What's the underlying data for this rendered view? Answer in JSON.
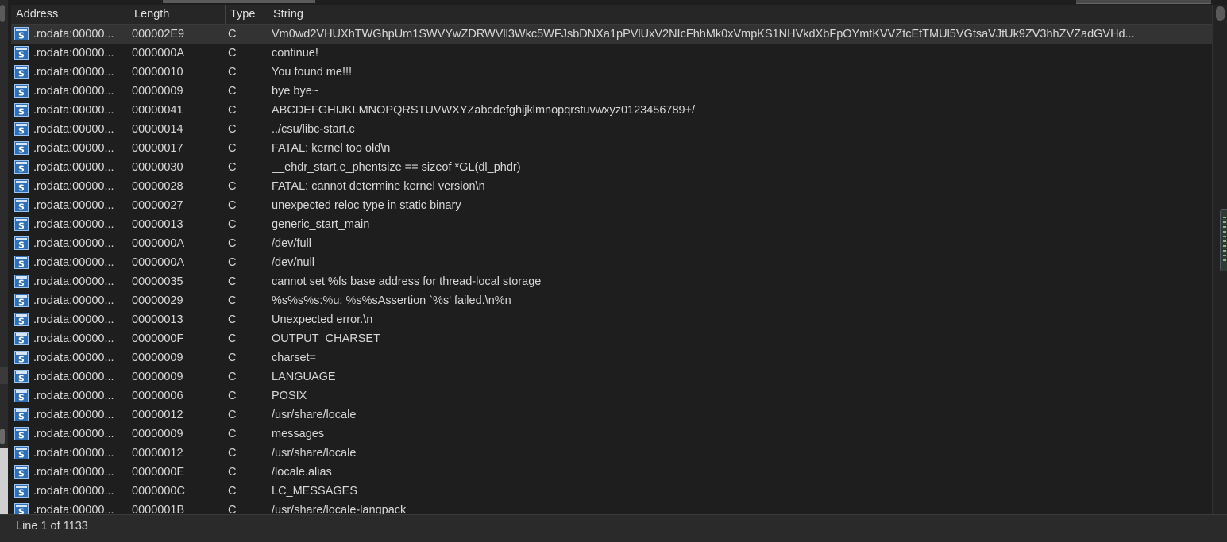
{
  "columns": {
    "address": "Address",
    "length": "Length",
    "type": "Type",
    "string": "String"
  },
  "icon": "string-segment-icon",
  "rows": [
    {
      "address": ".rodata:00000...",
      "length": "000002E9",
      "type": "C",
      "string": "Vm0wd2VHUXhTWGhpUm1SWVYwZDRWVll3Wkc5WFJsbDNXa1pPVlUxV2NIcFhhMk0xVmpKS1NHVkdXbFpOYmtKVVZtcEtTMUl5VGtsaVJtUk9ZV3hhZVZadGVHd..."
    },
    {
      "address": ".rodata:00000...",
      "length": "0000000A",
      "type": "C",
      "string": "continue!"
    },
    {
      "address": ".rodata:00000...",
      "length": "00000010",
      "type": "C",
      "string": "You found me!!!"
    },
    {
      "address": ".rodata:00000...",
      "length": "00000009",
      "type": "C",
      "string": "bye bye~"
    },
    {
      "address": ".rodata:00000...",
      "length": "00000041",
      "type": "C",
      "string": "ABCDEFGHIJKLMNOPQRSTUVWXYZabcdefghijklmnopqrstuvwxyz0123456789+/"
    },
    {
      "address": ".rodata:00000...",
      "length": "00000014",
      "type": "C",
      "string": "../csu/libc-start.c"
    },
    {
      "address": ".rodata:00000...",
      "length": "00000017",
      "type": "C",
      "string": "FATAL: kernel too old\\n"
    },
    {
      "address": ".rodata:00000...",
      "length": "00000030",
      "type": "C",
      "string": "__ehdr_start.e_phentsize == sizeof *GL(dl_phdr)"
    },
    {
      "address": ".rodata:00000...",
      "length": "00000028",
      "type": "C",
      "string": "FATAL: cannot determine kernel version\\n"
    },
    {
      "address": ".rodata:00000...",
      "length": "00000027",
      "type": "C",
      "string": "unexpected reloc type in static binary"
    },
    {
      "address": ".rodata:00000...",
      "length": "00000013",
      "type": "C",
      "string": "generic_start_main"
    },
    {
      "address": ".rodata:00000...",
      "length": "0000000A",
      "type": "C",
      "string": "/dev/full"
    },
    {
      "address": ".rodata:00000...",
      "length": "0000000A",
      "type": "C",
      "string": "/dev/null"
    },
    {
      "address": ".rodata:00000...",
      "length": "00000035",
      "type": "C",
      "string": "cannot set %fs base address for thread-local storage"
    },
    {
      "address": ".rodata:00000...",
      "length": "00000029",
      "type": "C",
      "string": "%s%s%s:%u: %s%sAssertion `%s' failed.\\n%n"
    },
    {
      "address": ".rodata:00000...",
      "length": "00000013",
      "type": "C",
      "string": "Unexpected error.\\n"
    },
    {
      "address": ".rodata:00000...",
      "length": "0000000F",
      "type": "C",
      "string": "OUTPUT_CHARSET"
    },
    {
      "address": ".rodata:00000...",
      "length": "00000009",
      "type": "C",
      "string": "charset="
    },
    {
      "address": ".rodata:00000...",
      "length": "00000009",
      "type": "C",
      "string": "LANGUAGE"
    },
    {
      "address": ".rodata:00000...",
      "length": "00000006",
      "type": "C",
      "string": "POSIX"
    },
    {
      "address": ".rodata:00000...",
      "length": "00000012",
      "type": "C",
      "string": "/usr/share/locale"
    },
    {
      "address": ".rodata:00000...",
      "length": "00000009",
      "type": "C",
      "string": "messages"
    },
    {
      "address": ".rodata:00000...",
      "length": "00000012",
      "type": "C",
      "string": "/usr/share/locale"
    },
    {
      "address": ".rodata:00000...",
      "length": "0000000E",
      "type": "C",
      "string": "/locale.alias"
    },
    {
      "address": ".rodata:00000...",
      "length": "0000000C",
      "type": "C",
      "string": "LC_MESSAGES"
    },
    {
      "address": ".rodata:00000...",
      "length": "0000001B",
      "type": "C",
      "string": "/usr/share/locale-langpack"
    }
  ],
  "status": {
    "text": "Line 1 of 1133"
  }
}
